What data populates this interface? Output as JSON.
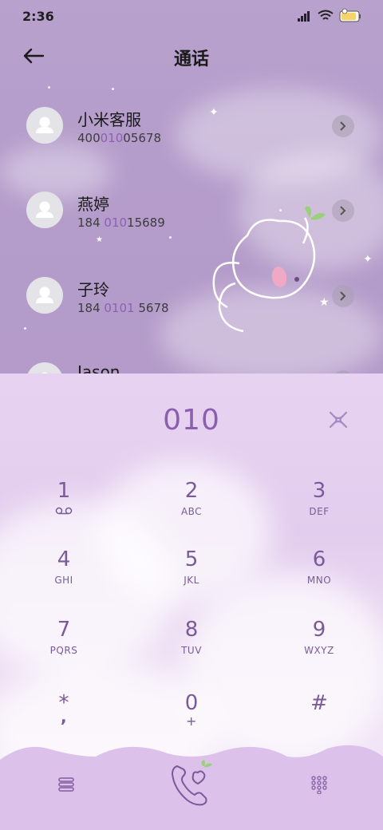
{
  "status_bar": {
    "time": "2:36"
  },
  "header": {
    "title": "通话"
  },
  "contacts": [
    {
      "name": "小米客服",
      "number_pre": "400",
      "number_hl": "010",
      "number_post": "05678"
    },
    {
      "name": "燕婷",
      "number_pre": "184 ",
      "number_hl": "010",
      "number_post": "15689"
    },
    {
      "name": "子玲",
      "number_pre": "184 ",
      "number_hl": "0101",
      "number_post": " 5678"
    },
    {
      "name": "Jason",
      "number_pre": "",
      "number_hl": "",
      "number_post": ""
    }
  ],
  "dialer": {
    "digits": "010",
    "keys": [
      {
        "num": "1",
        "sub": "voicemail-icon"
      },
      {
        "num": "2",
        "sub": "ABC"
      },
      {
        "num": "3",
        "sub": "DEF"
      },
      {
        "num": "4",
        "sub": "GHI"
      },
      {
        "num": "5",
        "sub": "JKL"
      },
      {
        "num": "6",
        "sub": "MNO"
      },
      {
        "num": "7",
        "sub": "PQRS"
      },
      {
        "num": "8",
        "sub": "TUV"
      },
      {
        "num": "9",
        "sub": "WXYZ"
      },
      {
        "num": "*",
        "sub": ","
      },
      {
        "num": "0",
        "sub": "+"
      },
      {
        "num": "#",
        "sub": ""
      }
    ]
  },
  "colors": {
    "accent": "#8b5fae",
    "key_text": "#7a5a9a",
    "top_bg": "#b8a1cd",
    "dialer_bg": "#e7d3f1"
  }
}
